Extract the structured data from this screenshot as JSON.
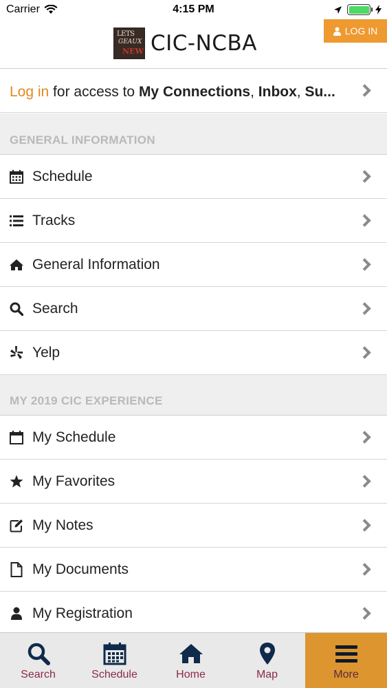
{
  "status_bar": {
    "carrier": "Carrier",
    "time": "4:15 PM"
  },
  "header": {
    "logo_lines": [
      "LETS",
      "GEAUX",
      "NEW"
    ],
    "title": "CIC-NCBA",
    "login_button": "LOG IN",
    "accent_color": "#ee9a30"
  },
  "login_prompt": {
    "link": "Log in",
    "text": " for access to ",
    "item1": "My Connections",
    "sep1": ", ",
    "item2": "Inbox",
    "sep2": ", ",
    "item3": "Su..."
  },
  "sections": [
    {
      "title": "GENERAL INFORMATION",
      "items": [
        {
          "label": "Schedule",
          "icon": "calendar-icon"
        },
        {
          "label": "Tracks",
          "icon": "list-icon"
        },
        {
          "label": "General Information",
          "icon": "home-icon"
        },
        {
          "label": "Search",
          "icon": "search-icon"
        },
        {
          "label": "Yelp",
          "icon": "yelp-icon"
        }
      ]
    },
    {
      "title": "MY 2019 CIC EXPERIENCE",
      "items": [
        {
          "label": "My Schedule",
          "icon": "calendar-outline-icon"
        },
        {
          "label": "My Favorites",
          "icon": "star-icon"
        },
        {
          "label": "My Notes",
          "icon": "edit-icon"
        },
        {
          "label": "My Documents",
          "icon": "document-icon"
        },
        {
          "label": "My Registration",
          "icon": "user-icon"
        }
      ]
    }
  ],
  "tab_bar": {
    "tabs": [
      {
        "label": "Search",
        "icon": "search-icon"
      },
      {
        "label": "Schedule",
        "icon": "calendar-icon"
      },
      {
        "label": "Home",
        "icon": "home-icon"
      },
      {
        "label": "Map",
        "icon": "map-pin-icon"
      },
      {
        "label": "More",
        "icon": "menu-icon",
        "active": true
      }
    ],
    "label_color": "#8b2a46",
    "active_color": "#dd9530"
  }
}
